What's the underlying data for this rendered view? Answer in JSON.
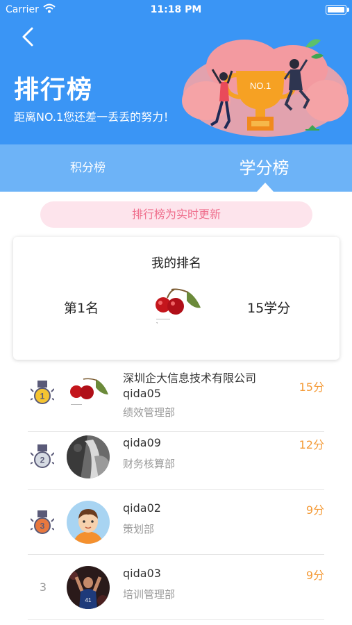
{
  "status_bar": {
    "carrier": "Carrier",
    "time": "11:18 PM"
  },
  "header": {
    "title": "排行榜",
    "subtitle": "距离NO.1您还差一丢丢的努力！",
    "trophy_text": "NO.1",
    "colors": {
      "background": "#3a95f5",
      "tab_bar": "#6db3f7"
    }
  },
  "tabs": [
    {
      "label": "积分榜",
      "active": false
    },
    {
      "label": "学分榜",
      "active": true
    }
  ],
  "notice": "排行榜为实时更新",
  "my_rank": {
    "title": "我的排名",
    "rank": "第1名",
    "score": "15学分"
  },
  "ranking": [
    {
      "medal": "gold",
      "medal_number": "1",
      "name": "深圳企大信息技术有限公司qida05",
      "dept": "绩效管理部",
      "score": "15分",
      "avatar": "cherry-avatar"
    },
    {
      "medal": "silver",
      "medal_number": "2",
      "name": "qida09",
      "dept": "财务核算部",
      "score": "12分",
      "avatar": "bw-photo-avatar"
    },
    {
      "medal": "bronze",
      "medal_number": "3",
      "name": "qida02",
      "dept": "策划部",
      "score": "9分",
      "avatar": "cartoon-boy-avatar"
    },
    {
      "rank": "3",
      "name": "qida03",
      "dept": "培训管理部",
      "score": "9分",
      "avatar": "basketball-player-avatar"
    }
  ],
  "colors": {
    "score": "#f49a36",
    "notice_text": "#ef6e8c",
    "notice_bg": "#fde4ec"
  }
}
